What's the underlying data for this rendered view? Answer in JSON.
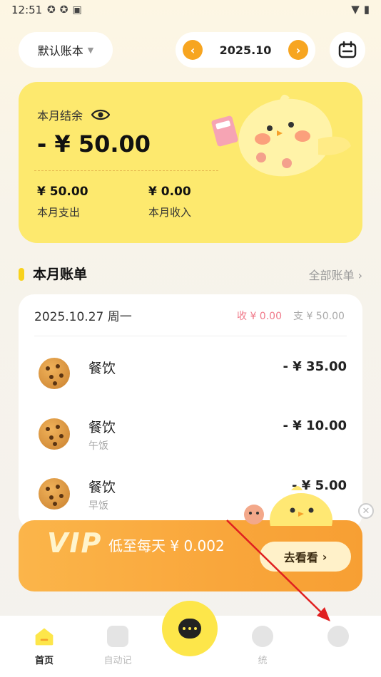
{
  "status_bar": {
    "time": "12:51"
  },
  "header": {
    "book_name": "默认账本",
    "month": "2025.10",
    "prev_symbol": "‹",
    "next_symbol": "›"
  },
  "summary": {
    "label": "本月结余",
    "balance": "- ¥ 50.00",
    "expense_value": "¥ 50.00",
    "expense_label": "本月支出",
    "income_value": "¥ 0.00",
    "income_label": "本月收入"
  },
  "bills": {
    "title": "本月账单",
    "all_link": "全部账单 ›",
    "date": "2025.10.27 周一",
    "income": "收 ¥ 0.00",
    "expense": "支 ¥ 50.00",
    "items": [
      {
        "category": "餐饮",
        "note": "",
        "amount": "- ¥ 35.00"
      },
      {
        "category": "餐饮",
        "note": "午饭",
        "amount": "- ¥ 10.00"
      },
      {
        "category": "餐饮",
        "note": "早饭",
        "amount": "- ¥ 5.00"
      }
    ]
  },
  "vip": {
    "word": "VIP",
    "slogan": "低至每天 ¥ 0.002",
    "button": "去看看",
    "button_chevron": "›"
  },
  "tabs": [
    {
      "label": "首页",
      "active": true
    },
    {
      "label": "自动记",
      "active": false
    },
    {
      "label": "统",
      "active": false
    },
    {
      "label": "",
      "active": false
    }
  ],
  "colors": {
    "accent_yellow": "#fde96e",
    "arrow_orange": "#f7a520",
    "income_pink": "#f07a8a",
    "annotation_red": "#e02020"
  }
}
